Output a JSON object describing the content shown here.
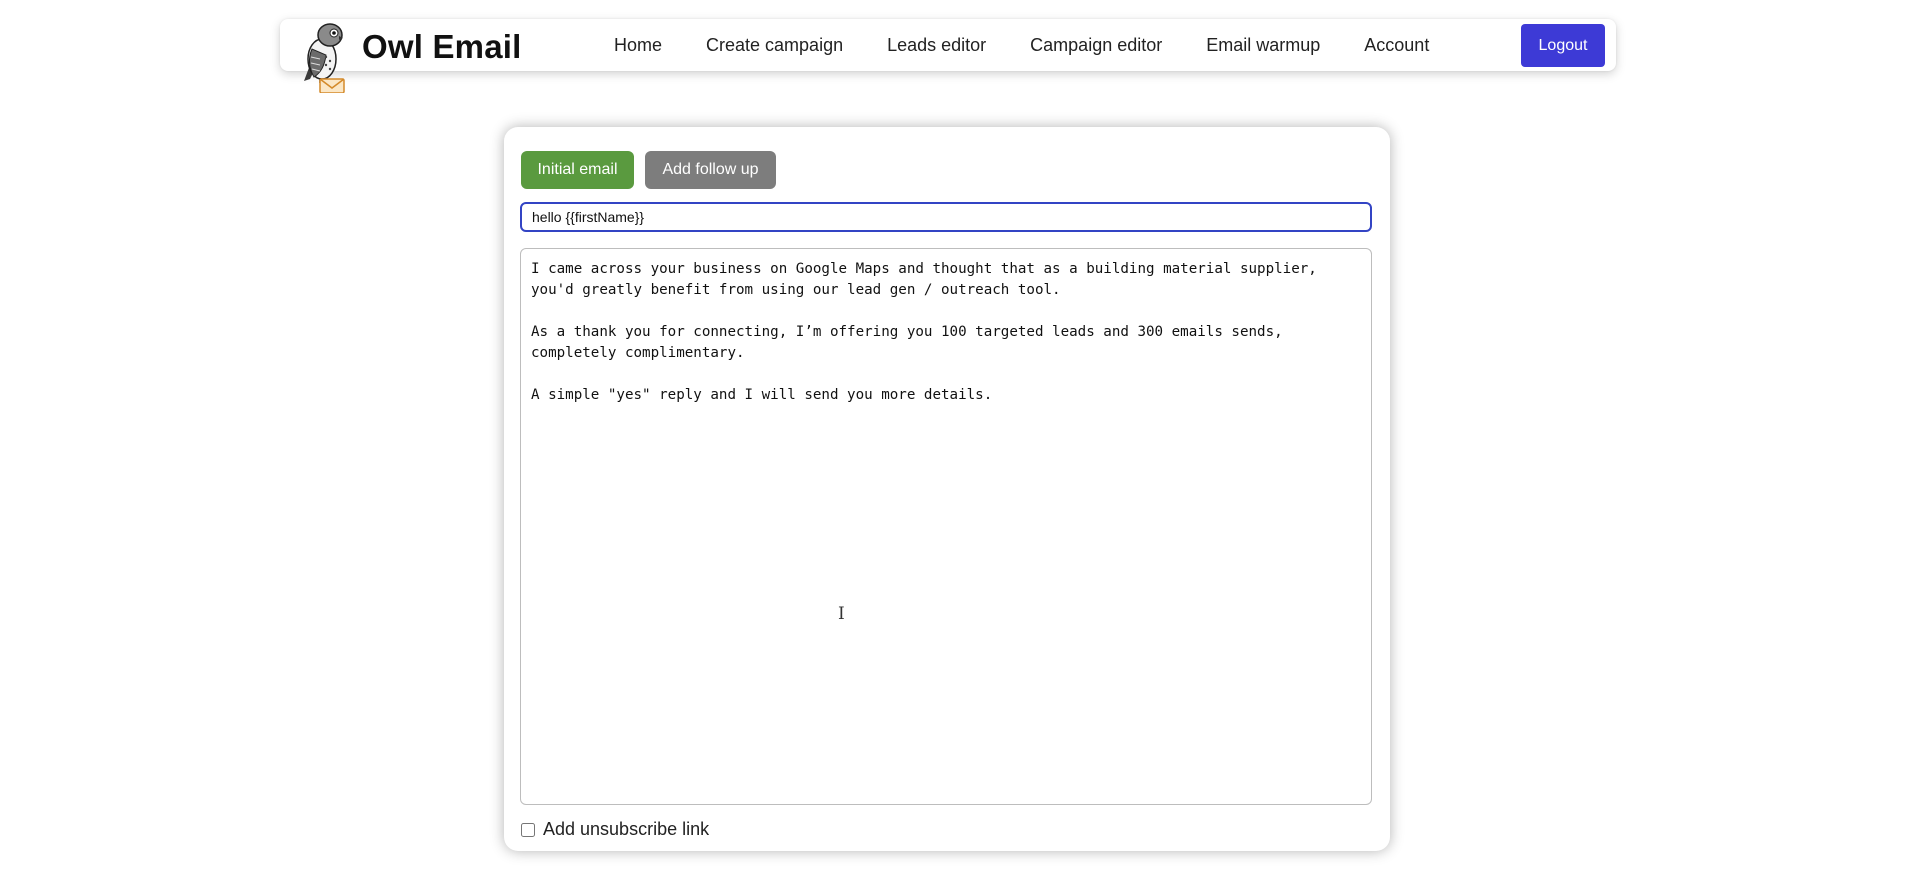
{
  "header": {
    "brand_title": "Owl Email",
    "logo_icon": "owl-with-envelope-icon",
    "nav": [
      {
        "label": "Home"
      },
      {
        "label": "Create campaign"
      },
      {
        "label": "Leads editor"
      },
      {
        "label": "Campaign editor"
      },
      {
        "label": "Email warmup"
      },
      {
        "label": "Account"
      }
    ],
    "logout_label": "Logout"
  },
  "editor": {
    "tabs": [
      {
        "label": "Initial email",
        "active": true,
        "color": "#5a9a3f"
      },
      {
        "label": "Add follow up",
        "active": false,
        "color": "#7d7d7d"
      }
    ],
    "subject_value": "hello {{firstName}}",
    "body_value": "I came across your business on Google Maps and thought that as a building material supplier,\nyou'd greatly benefit from using our lead gen / outreach tool.\n\nAs a thank you for connecting, I’m offering you 100 targeted leads and 300 emails sends,\ncompletely complimentary.\n\nA simple \"yes\" reply and I will send you more details.",
    "unsubscribe_label": "Add unsubscribe link",
    "unsubscribe_checked": false
  },
  "colors": {
    "logout_button": "#3d3ad6",
    "subject_border": "#3344c4"
  }
}
